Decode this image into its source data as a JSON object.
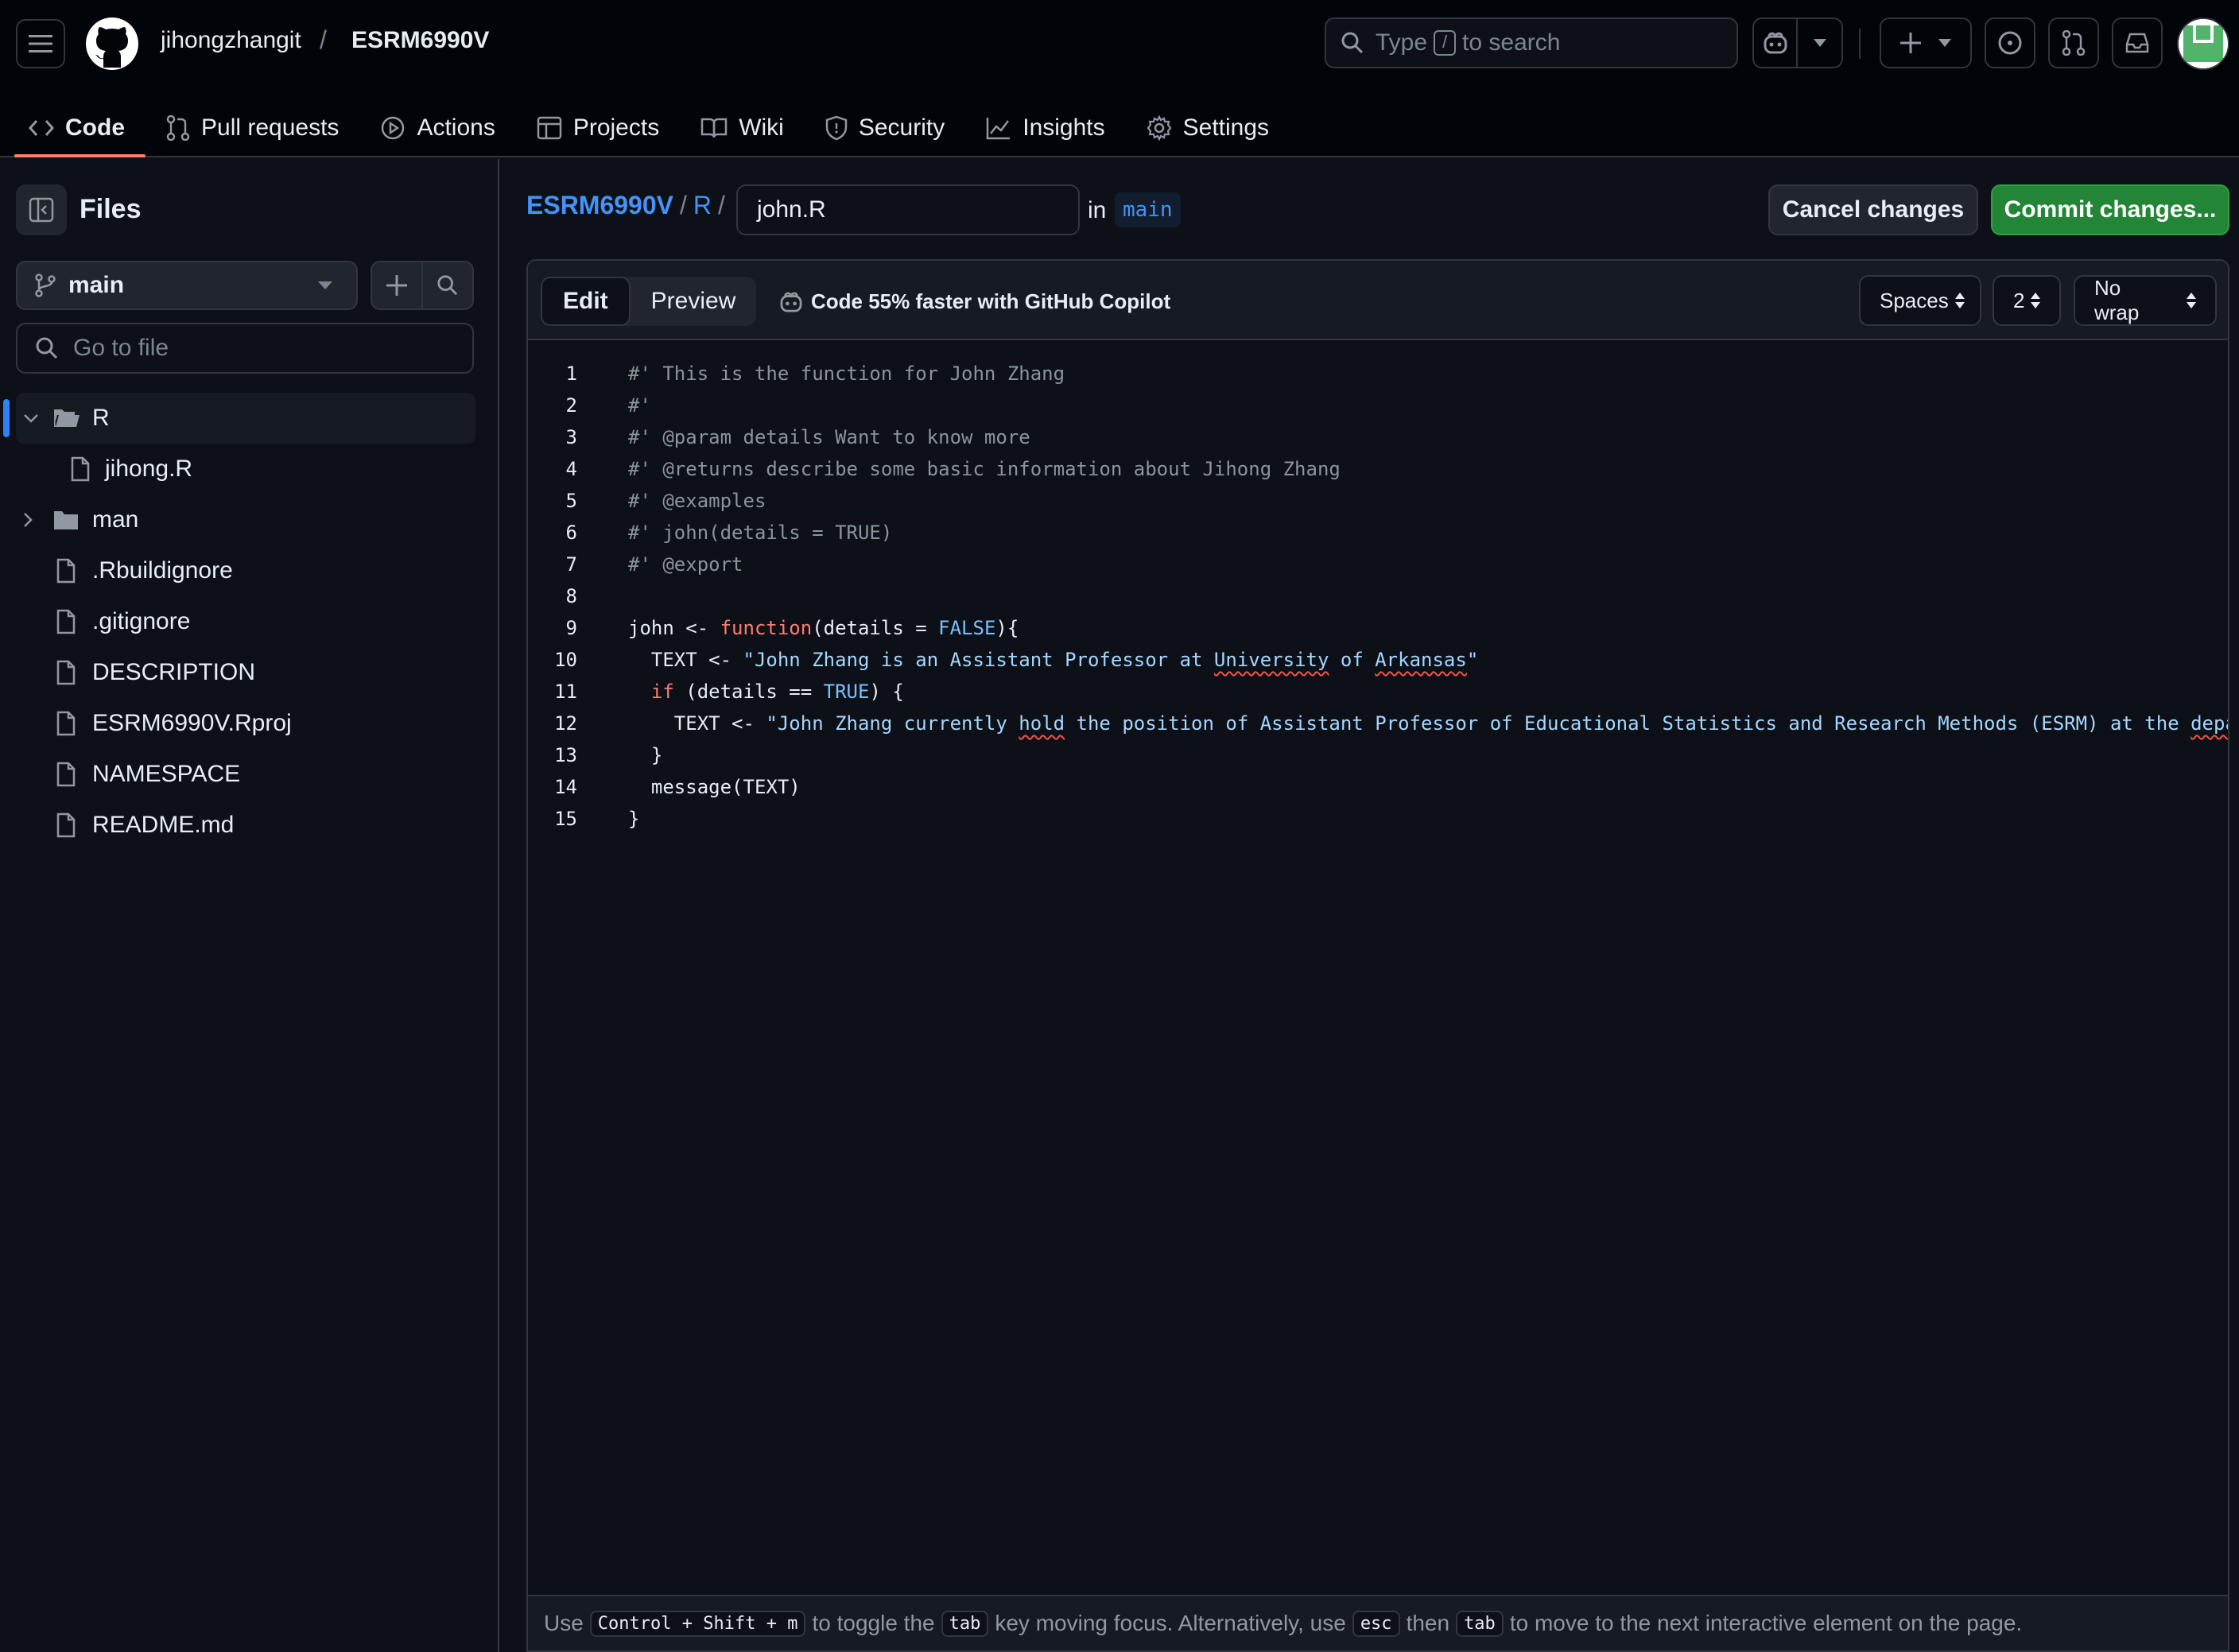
{
  "header": {
    "owner": "jihongzhangit",
    "separator": "/",
    "repo": "ESRM6990V",
    "search_prefix": "Type",
    "search_key": "/",
    "search_suffix": "to search"
  },
  "nav": {
    "items": [
      {
        "label": "Code",
        "icon": "code-icon",
        "active": true
      },
      {
        "label": "Pull requests",
        "icon": "pull-request-icon"
      },
      {
        "label": "Actions",
        "icon": "play-icon"
      },
      {
        "label": "Projects",
        "icon": "table-icon"
      },
      {
        "label": "Wiki",
        "icon": "book-icon"
      },
      {
        "label": "Security",
        "icon": "shield-icon"
      },
      {
        "label": "Insights",
        "icon": "graph-icon"
      },
      {
        "label": "Settings",
        "icon": "gear-icon"
      }
    ]
  },
  "sidebar": {
    "title": "Files",
    "branch": "main",
    "goto_placeholder": "Go to file",
    "tree": [
      {
        "label": "R",
        "type": "folder-open"
      },
      {
        "label": "jihong.R",
        "type": "file"
      },
      {
        "label": "man",
        "type": "folder"
      },
      {
        "label": ".Rbuildignore",
        "type": "file"
      },
      {
        "label": ".gitignore",
        "type": "file"
      },
      {
        "label": "DESCRIPTION",
        "type": "file"
      },
      {
        "label": "ESRM6990V.Rproj",
        "type": "file"
      },
      {
        "label": "NAMESPACE",
        "type": "file"
      },
      {
        "label": "README.md",
        "type": "file"
      }
    ]
  },
  "editor": {
    "crumb_repo": "ESRM6990V",
    "crumb_dir": "R",
    "crumb_sep": "/",
    "filename": "john.R",
    "in_label": "in",
    "branch": "main",
    "cancel_label": "Cancel changes",
    "commit_label": "Commit changes...",
    "tab_edit": "Edit",
    "tab_preview": "Preview",
    "copilot_text": "Code 55% faster with GitHub Copilot",
    "indent_mode": "Spaces",
    "indent_size": "2",
    "wrap_mode": "No wrap",
    "line_numbers": [
      "1",
      "2",
      "3",
      "4",
      "5",
      "6",
      "7",
      "8",
      "9",
      "10",
      "11",
      "12",
      "13",
      "14",
      "15"
    ],
    "code": {
      "l1": "#' This is the function for John Zhang",
      "l2": "#'",
      "l3": "#' @param details Want to know more",
      "l4": "#' @returns describe some basic information about Jihong Zhang",
      "l5": "#' @examples",
      "l6": "#' john(details = TRUE)",
      "l7": "#' @export",
      "l9_a": "john <- ",
      "l9_fn": "function",
      "l9_b": "(details = ",
      "l9_con": "FALSE",
      "l9_c": "){",
      "l10_a": "  TEXT <- ",
      "l10_s1": "\"John Zhang is an Assistant Professor at ",
      "l10_s2": "University",
      "l10_s3": " of ",
      "l10_s4": "Arkansas",
      "l10_s5": "\"",
      "l11_kw": "if",
      "l11_a": " (details == ",
      "l11_con": "TRUE",
      "l11_b": ") {",
      "l12_a": "    TEXT <- ",
      "l12_s1": "\"John Zhang currently ",
      "l12_s2": "hold",
      "l12_s3": " the position of Assistant Professor of Educational Statistics and Research Methods (ESRM) at the ",
      "l12_s4": "depa",
      "l13": "  }",
      "l14": "  message(TEXT)",
      "l15": "}"
    }
  },
  "footer": {
    "t1": "Use",
    "k1": "Control + Shift + m",
    "t2": "to toggle the",
    "k2": "tab",
    "t3": "key moving focus. Alternatively, use",
    "k3": "esc",
    "t4": "then",
    "k4": "tab",
    "t5": "to move to the next interactive element on the page."
  }
}
